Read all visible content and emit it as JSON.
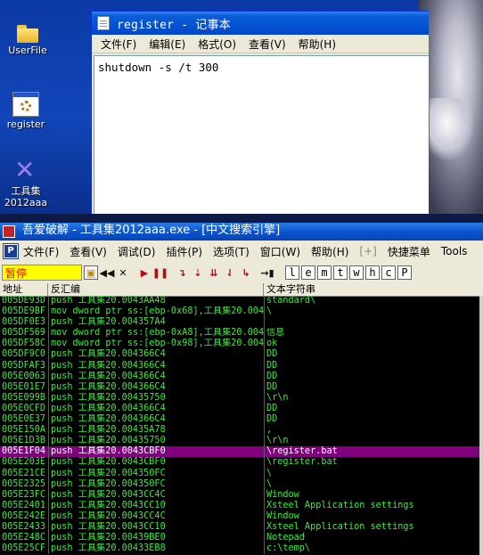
{
  "desktop": {
    "icons": [
      {
        "label": "UserFile",
        "icon": "folder-icon"
      },
      {
        "label": "register",
        "icon": "batch-file-icon"
      },
      {
        "label": "工具集",
        "label2": "2012aaa",
        "icon": "tool-x-icon"
      }
    ]
  },
  "notepad": {
    "title": "register - 记事本",
    "menu": [
      "文件(F)",
      "编辑(E)",
      "格式(O)",
      "查看(V)",
      "帮助(H)"
    ],
    "content": "shutdown -s /t 300"
  },
  "debugger": {
    "title": "吾爱破解 - 工具集2012aaa.exe - [中文搜索引擎]",
    "menu": [
      "文件(F)",
      "查看(V)",
      "调试(D)",
      "插件(P)",
      "选项(T)",
      "窗口(W)",
      "帮助(H)",
      "[+]",
      "快捷菜单",
      "Tools"
    ],
    "status": "暂停",
    "toolbar_letters": [
      "l",
      "e",
      "m",
      "t",
      "w",
      "h",
      "c",
      "P"
    ],
    "columns": [
      "地址",
      "反汇编",
      "文本字符串"
    ],
    "rows": [
      {
        "addr": "005DE93D",
        "asm": "push 工具集20.0043AA48",
        "text": "standard\\"
      },
      {
        "addr": "005DE9BF",
        "asm": "mov dword ptr ss:[ebp-0x68],工具集20.004",
        "text": "\\"
      },
      {
        "addr": "005DF0E3",
        "asm": "push 工具集20.004357A4",
        "text": ""
      },
      {
        "addr": "005DF569",
        "asm": "mov dword ptr ss:[ebp-0xA8],工具集20.004",
        "text": "信息"
      },
      {
        "addr": "005DF58C",
        "asm": "mov dword ptr ss:[ebp-0x98],工具集20.004",
        "text": "  ok"
      },
      {
        "addr": "005DF9C0",
        "asm": "push 工具集20.004366C4",
        "text": "DD"
      },
      {
        "addr": "005DFAF3",
        "asm": "push 工具集20.004366C4",
        "text": "DD"
      },
      {
        "addr": "005E0063",
        "asm": "push 工具集20.004366C4",
        "text": "DD"
      },
      {
        "addr": "005E01E7",
        "asm": "push 工具集20.004366C4",
        "text": "DD"
      },
      {
        "addr": "005E099B",
        "asm": "push 工具集20.00435750",
        "text": "\\r\\n"
      },
      {
        "addr": "005E0CFD",
        "asm": "push 工具集20.004366C4",
        "text": "DD"
      },
      {
        "addr": "005E0E37",
        "asm": "push 工具集20.004366C4",
        "text": "DD"
      },
      {
        "addr": "005E150A",
        "asm": "push 工具集20.00435A78",
        "text": ","
      },
      {
        "addr": "005E1D3B",
        "asm": "push 工具集20.00435750",
        "text": "\\r\\n"
      },
      {
        "addr": "005E1F04",
        "asm": "push 工具集20.0043CBF0",
        "text": "\\register.bat",
        "selected": true
      },
      {
        "addr": "005E203E",
        "asm": "push 工具集20.0043CBF0",
        "text": "\\register.bat"
      },
      {
        "addr": "005E21CE",
        "asm": "push 工具集20.004350FC",
        "text": "\\"
      },
      {
        "addr": "005E2325",
        "asm": "push 工具集20.004350FC",
        "text": "\\"
      },
      {
        "addr": "005E23FC",
        "asm": "push 工具集20.0043CC4C",
        "text": "Window"
      },
      {
        "addr": "005E2401",
        "asm": "push 工具集20.0043CC10",
        "text": "Xsteel Application settings"
      },
      {
        "addr": "005E242E",
        "asm": "push 工具集20.0043CC4C",
        "text": "Window"
      },
      {
        "addr": "005E2433",
        "asm": "push 工具集20.0043CC10",
        "text": "Xsteel Application settings"
      },
      {
        "addr": "005E248C",
        "asm": "push 工具集20.00439BE0",
        "text": "Notepad"
      },
      {
        "addr": "005E25CF",
        "asm": "push 工具集20.00433EB8",
        "text": "c:\\temp\\"
      }
    ]
  },
  "colors": {
    "listing_text": "#3fe83f",
    "selection": "#800080",
    "status_bg": "#ffff00",
    "status_fg": "#ff0000"
  }
}
